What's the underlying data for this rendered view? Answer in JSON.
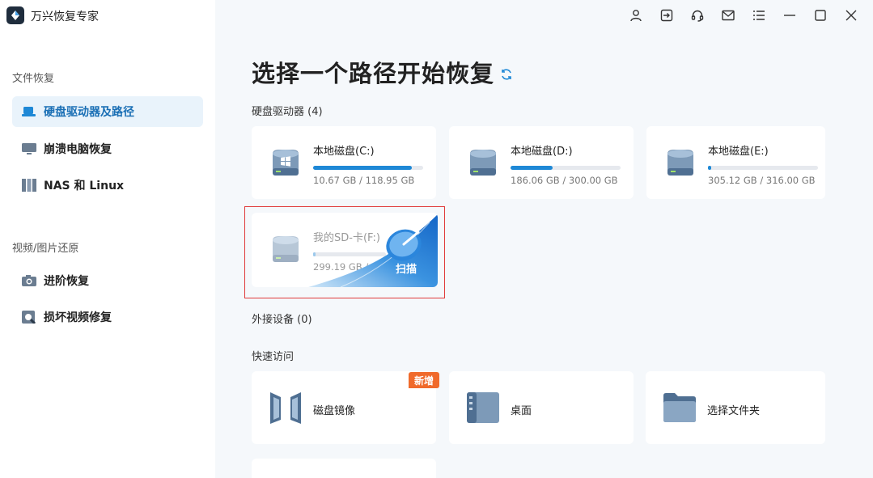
{
  "app": {
    "title": "万兴恢复专家"
  },
  "sidebar": {
    "sections": [
      {
        "label": "文件恢复",
        "items": [
          {
            "label": "硬盘驱动器及路径",
            "icon": "hard-drive-icon",
            "active": true
          },
          {
            "label": "崩溃电脑恢复",
            "icon": "monitor-icon",
            "active": false
          },
          {
            "label": "NAS 和 Linux",
            "icon": "nas-icon",
            "active": false
          }
        ]
      },
      {
        "label": "视频/图片还原",
        "items": [
          {
            "label": "进阶恢复",
            "icon": "camera-icon",
            "active": false
          },
          {
            "label": "损坏视频修复",
            "icon": "video-repair-icon",
            "active": false
          }
        ]
      }
    ]
  },
  "titlebar": {
    "icons": [
      "user-icon",
      "sign-in-icon",
      "headset-icon",
      "mail-icon",
      "menu-icon",
      "minimize-icon",
      "maximize-icon",
      "close-icon"
    ]
  },
  "main": {
    "title": "选择一个路径开始恢复",
    "drives_label": "硬盘驱动器",
    "drives_count": "(4)",
    "drives": [
      {
        "name": "本地磁盘(C:)",
        "size": "10.67 GB / 118.95 GB",
        "usage": 0.9,
        "icon": "windows-drive-icon"
      },
      {
        "name": "本地磁盘(D:)",
        "size": "186.06 GB / 300.00 GB",
        "usage": 0.38,
        "icon": "drive-icon"
      },
      {
        "name": "本地磁盘(E:)",
        "size": "305.12 GB / 316.00 GB",
        "usage": 0.03,
        "icon": "drive-icon"
      },
      {
        "name": "我的SD-卡(F:)",
        "size": "299.19 GB / 315",
        "usage": 0.03,
        "icon": "sd-drive-icon",
        "scan_label": "扫描"
      }
    ],
    "external_label": "外接设备",
    "external_count": "(0)",
    "quick_label": "快速访问",
    "quick": [
      {
        "label": "磁盘镜像",
        "icon": "disk-image-icon",
        "badge": "新增"
      },
      {
        "label": "桌面",
        "icon": "desktop-icon"
      },
      {
        "label": "选择文件夹",
        "icon": "folder-icon"
      }
    ]
  },
  "colors": {
    "accent": "#1e88d6",
    "active_bg": "#e9f3fb",
    "badge": "#f06a2b",
    "selection_border": "#e03a3a"
  }
}
